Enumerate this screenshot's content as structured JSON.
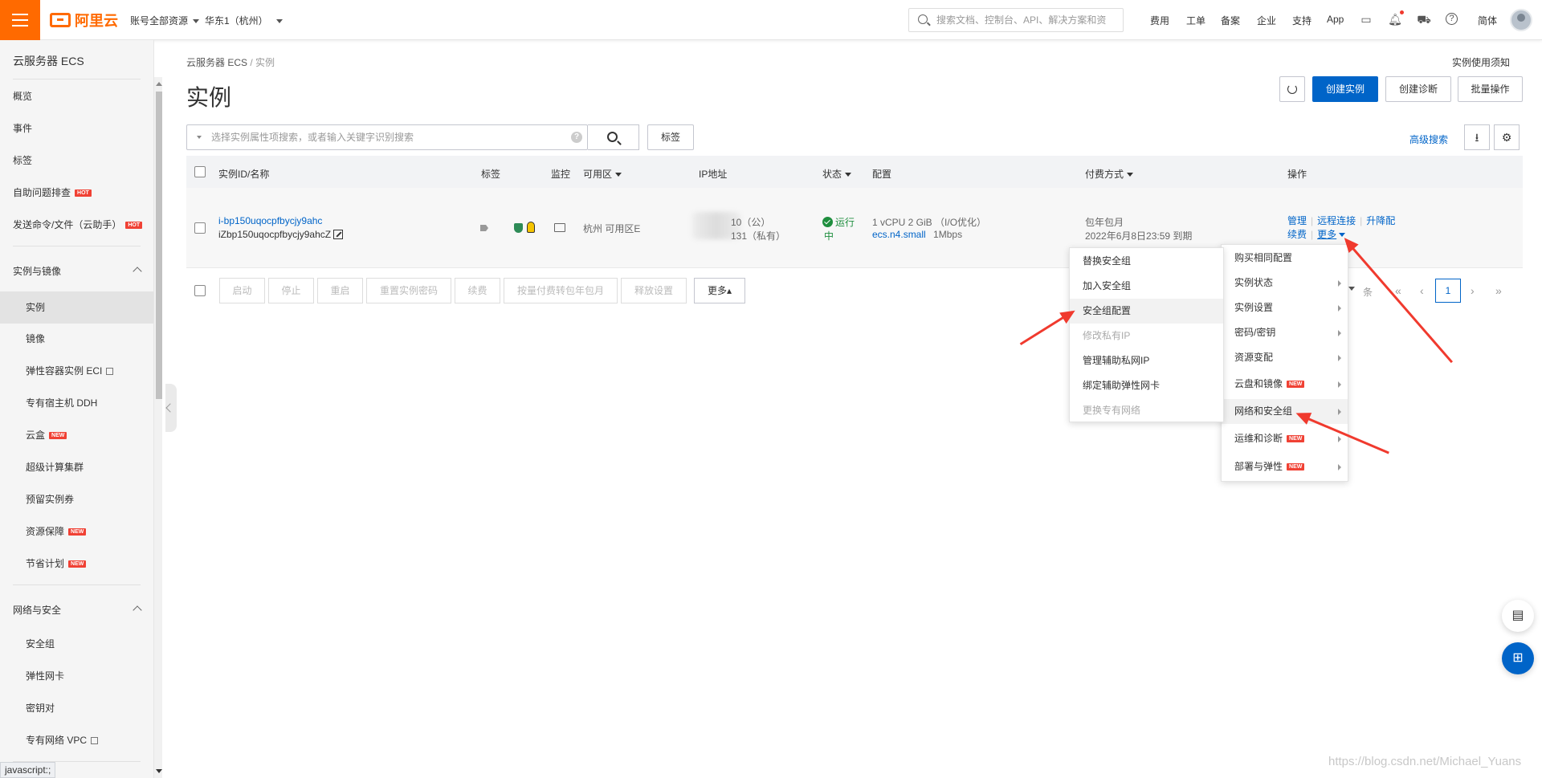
{
  "header": {
    "logo_text": "阿里云",
    "account_scope": "账号全部资源",
    "region": "华东1（杭州）",
    "search_placeholder": "搜索文档、控制台、API、解决方案和资",
    "links": [
      "费用",
      "工单",
      "备案",
      "企业",
      "支持",
      "App"
    ],
    "lang": "简体"
  },
  "sidebar": {
    "title": "云服务器 ECS",
    "top_items": [
      {
        "label": "概览"
      },
      {
        "label": "事件"
      },
      {
        "label": "标签"
      },
      {
        "label": "自助问题排查",
        "badge": "HOT"
      },
      {
        "label": "发送命令/文件（云助手）",
        "badge": "HOT"
      }
    ],
    "group1": "实例与镜像",
    "group1_items": [
      {
        "label": "实例"
      },
      {
        "label": "镜像"
      },
      {
        "label": "弹性容器实例 ECI"
      },
      {
        "label": "专有宿主机 DDH"
      },
      {
        "label": "云盒",
        "badge": "NEW"
      },
      {
        "label": "超级计算集群"
      },
      {
        "label": "预留实例券"
      },
      {
        "label": "资源保障",
        "badge": "NEW"
      },
      {
        "label": "节省计划",
        "badge": "NEW"
      }
    ],
    "group2": "网络与安全",
    "group2_items": [
      {
        "label": "安全组"
      },
      {
        "label": "弹性网卡"
      },
      {
        "label": "密钥对"
      },
      {
        "label": "专有网络 VPC"
      }
    ],
    "status_tip": "javascript:;"
  },
  "page": {
    "breadcrumb": [
      "云服务器 ECS",
      "/",
      "实例"
    ],
    "notice": "实例使用须知",
    "title": "实例",
    "btn_create": "创建实例",
    "btn_diagnose": "创建诊断",
    "btn_batch": "批量操作",
    "filter_placeholder": "选择实例属性项搜索，或者输入关键字识别搜索",
    "btn_tag": "标签",
    "advanced_search": "高级搜索"
  },
  "table": {
    "headers": [
      "实例ID/名称",
      "标签",
      "监控",
      "可用区",
      "IP地址",
      "状态",
      "配置",
      "付费方式",
      "操作"
    ],
    "row": {
      "instance_id": "i-bp150uqocpfbycjy9ahc",
      "instance_name": "iZbp150uqocpfbycjy9ahcZ",
      "zone": "杭州 可用区E",
      "ip_public": "10（公）",
      "ip_private": "131（私有）",
      "status_line1": "运行",
      "status_line2": "中",
      "config_line1": "1 vCPU 2 GiB （I/O优化）",
      "config_type": "ecs.n4.small",
      "config_bw": "1Mbps",
      "billing": "包年包月",
      "expire": "2022年6月8日23:59 到期",
      "op_manage": "管理",
      "op_remote": "远程连接",
      "op_upgrade": "升降配",
      "op_renew": "续费",
      "op_more": "更多"
    }
  },
  "bulk_bar": {
    "buttons": [
      "启动",
      "停止",
      "重启",
      "重置实例密码",
      "续费",
      "按量付费转包年包月",
      "释放设置"
    ],
    "more": "更多▴",
    "page_size_suffix": "条",
    "current_page": "1"
  },
  "more_menu": {
    "items": [
      {
        "label": "购买相同配置",
        "arrow": false
      },
      {
        "label": "实例状态",
        "arrow": true
      },
      {
        "label": "实例设置",
        "arrow": true
      },
      {
        "label": "密码/密钥",
        "arrow": true
      },
      {
        "label": "资源变配",
        "arrow": true
      },
      {
        "label": "云盘和镜像",
        "arrow": true,
        "badge": "NEW"
      },
      {
        "label": "网络和安全组",
        "arrow": true
      },
      {
        "label": "运维和诊断",
        "arrow": true,
        "badge": "NEW"
      },
      {
        "label": "部署与弹性",
        "arrow": true,
        "badge": "NEW"
      }
    ]
  },
  "network_submenu": {
    "items": [
      {
        "label": "替换安全组",
        "disabled": false
      },
      {
        "label": "加入安全组",
        "disabled": false
      },
      {
        "label": "安全组配置",
        "disabled": false
      },
      {
        "label": "修改私有IP",
        "disabled": true
      },
      {
        "label": "管理辅助私网IP",
        "disabled": false
      },
      {
        "label": "绑定辅助弹性网卡",
        "disabled": false
      },
      {
        "label": "更换专有网络",
        "disabled": true
      }
    ]
  },
  "watermark": "https://blog.csdn.net/Michael_Yuans",
  "colors": {
    "brand": "#ff6a00",
    "primary": "#0064c8",
    "annotation": "#f03a2e",
    "running": "#1e8e3e"
  }
}
